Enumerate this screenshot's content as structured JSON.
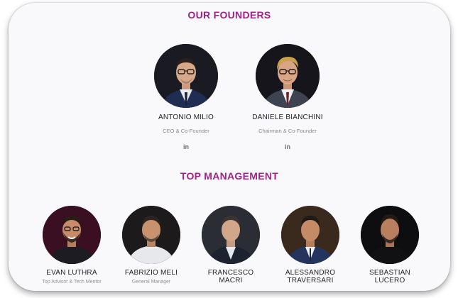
{
  "colors": {
    "accent": "#a1218a"
  },
  "founders": {
    "title": "OUR FOUNDERS",
    "people": [
      {
        "name": "ANTONIO MILIO",
        "role": "CEO & Co-Founder",
        "social_icon": "linkedin-icon",
        "social_label": "in"
      },
      {
        "name": "DANIELE BIANCHINI",
        "role": "Chairman & Co-Founder",
        "social_icon": "linkedin-icon",
        "social_label": "in"
      }
    ]
  },
  "management": {
    "title": "TOP MANAGEMENT",
    "people": [
      {
        "name": "EVAN LUTHRA",
        "role": "Top Advisor & Tech Mentor"
      },
      {
        "name": "FABRIZIO MELI",
        "role": "General Manager"
      },
      {
        "name": "FRANCESCO MACRI",
        "role": ""
      },
      {
        "name": "ALESSANDRO TRAVERSARI",
        "role": ""
      },
      {
        "name": "SEBASTIAN LUCERO",
        "role": ""
      }
    ]
  }
}
